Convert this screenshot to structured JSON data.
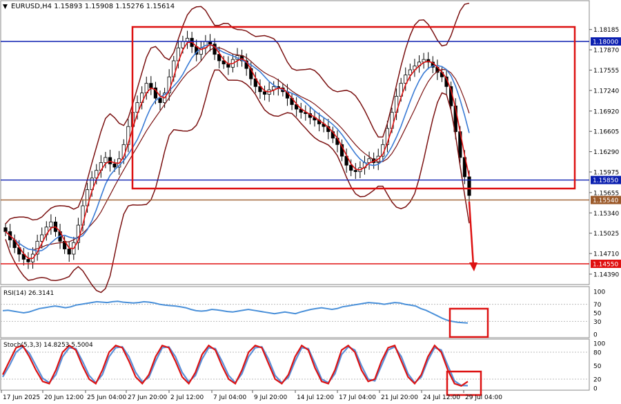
{
  "header": {
    "symbol_line": "EURUSD,H4  1.15893 1.15908 1.15276 1.15614"
  },
  "colors": {
    "candle": "#000000",
    "ma_fast": "#dd1111",
    "ma_slow": "#3a7bd5",
    "bollinger": "#7a1010",
    "level_blue": "#0b1fb0",
    "level_red": "#e01010",
    "level_brown": "#9c5a2a",
    "rsi": "#4a90d9",
    "stoch_main": "#dd1111",
    "stoch_signal": "#5a8fd8",
    "box": "#dd1111"
  },
  "chart_data": [
    {
      "type": "line",
      "panel": "price",
      "title": "EURUSD,H4",
      "ohlc_last": {
        "open": 1.15893,
        "high": 1.15908,
        "low": 1.15276,
        "close": 1.15614
      },
      "y_ticks": [
        "1.18185",
        "1.17870",
        "1.17555",
        "1.17240",
        "1.16920",
        "1.16605",
        "1.16290",
        "1.15975",
        "1.15655",
        "1.15340",
        "1.15025",
        "1.14710",
        "1.14390"
      ],
      "ylim": [
        1.1425,
        1.1845
      ],
      "x_ticks": [
        "17 Jun 2025",
        "20 Jun 12:00",
        "25 Jun 04:00",
        "27 Jun 20:00",
        "2 Jul 12:00",
        "7 Jul 04:00",
        "9 Jul 20:00",
        "14 Jul 12:00",
        "17 Jul 04:00",
        "21 Jul 20:00",
        "24 Jul 12:00",
        "29 Jul 04:00"
      ],
      "levels": [
        {
          "value": 1.18,
          "label": "1.18000",
          "color": "blue"
        },
        {
          "value": 1.1585,
          "label": "1.15850",
          "color": "blue"
        },
        {
          "value": 1.1554,
          "label": "1.15540",
          "color": "brown"
        },
        {
          "value": 1.1455,
          "label": "1.14550",
          "color": "red"
        }
      ],
      "close_series": [
        1.1505,
        1.1492,
        1.148,
        1.147,
        1.1462,
        1.1458,
        1.147,
        1.149,
        1.15,
        1.1512,
        1.152,
        1.1505,
        1.149,
        1.1478,
        1.147,
        1.1488,
        1.1515,
        1.1545,
        1.157,
        1.1588,
        1.16,
        1.1612,
        1.162,
        1.161,
        1.1605,
        1.1618,
        1.164,
        1.1668,
        1.169,
        1.1705,
        1.172,
        1.1735,
        1.1728,
        1.1712,
        1.1705,
        1.172,
        1.1745,
        1.177,
        1.179,
        1.18,
        1.1805,
        1.1792,
        1.178,
        1.179,
        1.18,
        1.1796,
        1.178,
        1.177,
        1.1765,
        1.176,
        1.1772,
        1.1778,
        1.177,
        1.1758,
        1.1742,
        1.173,
        1.1722,
        1.1718,
        1.1725,
        1.173,
        1.1728,
        1.1722,
        1.1712,
        1.1702,
        1.1695,
        1.169,
        1.1688,
        1.1682,
        1.1678,
        1.1672,
        1.1668,
        1.166,
        1.165,
        1.164,
        1.1622,
        1.1608,
        1.16,
        1.1598,
        1.1604,
        1.1612,
        1.1618,
        1.1612,
        1.1622,
        1.164,
        1.1665,
        1.169,
        1.1715,
        1.1735,
        1.1748,
        1.1756,
        1.1762,
        1.1768,
        1.1772,
        1.1768,
        1.176,
        1.1752,
        1.1745,
        1.173,
        1.17,
        1.166,
        1.162,
        1.159,
        1.1561
      ]
    },
    {
      "type": "line",
      "panel": "rsi",
      "title": "RSI(14) 26.3141",
      "ylim": [
        0,
        100
      ],
      "y_ticks": [
        "100",
        "70",
        "50",
        "30",
        "0"
      ],
      "values": [
        55,
        56,
        54,
        52,
        50,
        52,
        56,
        60,
        62,
        64,
        66,
        64,
        62,
        64,
        68,
        70,
        72,
        74,
        76,
        75,
        74,
        76,
        77,
        75,
        74,
        73,
        74,
        76,
        75,
        73,
        70,
        68,
        67,
        66,
        64,
        62,
        58,
        55,
        54,
        55,
        58,
        57,
        55,
        53,
        52,
        54,
        56,
        58,
        56,
        54,
        52,
        50,
        48,
        50,
        52,
        50,
        48,
        52,
        55,
        58,
        60,
        62,
        60,
        58,
        60,
        64,
        66,
        68,
        70,
        72,
        74,
        73,
        72,
        70,
        72,
        74,
        73,
        70,
        68,
        66,
        60,
        56,
        50,
        44,
        38,
        33,
        30,
        28,
        27,
        26.3
      ]
    },
    {
      "type": "line",
      "panel": "stochastic",
      "title": "Stoch(5,3,3) 14.8253 5.5004",
      "ylim": [
        0,
        100
      ],
      "y_ticks": [
        "100",
        "80",
        "50",
        "20",
        "0"
      ],
      "series": [
        {
          "name": "14.8253",
          "values": [
            30,
            60,
            90,
            95,
            70,
            40,
            15,
            10,
            40,
            80,
            95,
            85,
            50,
            20,
            10,
            40,
            80,
            95,
            90,
            60,
            25,
            10,
            30,
            70,
            95,
            90,
            60,
            25,
            10,
            35,
            75,
            95,
            85,
            50,
            20,
            10,
            40,
            80,
            95,
            90,
            55,
            20,
            10,
            30,
            70,
            95,
            85,
            45,
            15,
            10,
            40,
            85,
            95,
            80,
            40,
            15,
            20,
            60,
            90,
            95,
            60,
            25,
            10,
            30,
            70,
            95,
            80,
            40,
            10,
            5,
            14.8
          ]
        },
        {
          "name": "5.5004",
          "values": [
            25,
            50,
            80,
            92,
            78,
            50,
            22,
            12,
            30,
            70,
            90,
            88,
            60,
            28,
            12,
            30,
            70,
            90,
            92,
            70,
            35,
            14,
            24,
            60,
            90,
            92,
            70,
            35,
            14,
            28,
            65,
            90,
            88,
            60,
            28,
            12,
            32,
            70,
            90,
            92,
            65,
            28,
            12,
            24,
            60,
            90,
            88,
            55,
            20,
            12,
            32,
            75,
            92,
            85,
            50,
            20,
            16,
            50,
            85,
            92,
            70,
            32,
            12,
            25,
            62,
            90,
            85,
            50,
            16,
            6,
            5.5
          ]
        }
      ]
    }
  ]
}
